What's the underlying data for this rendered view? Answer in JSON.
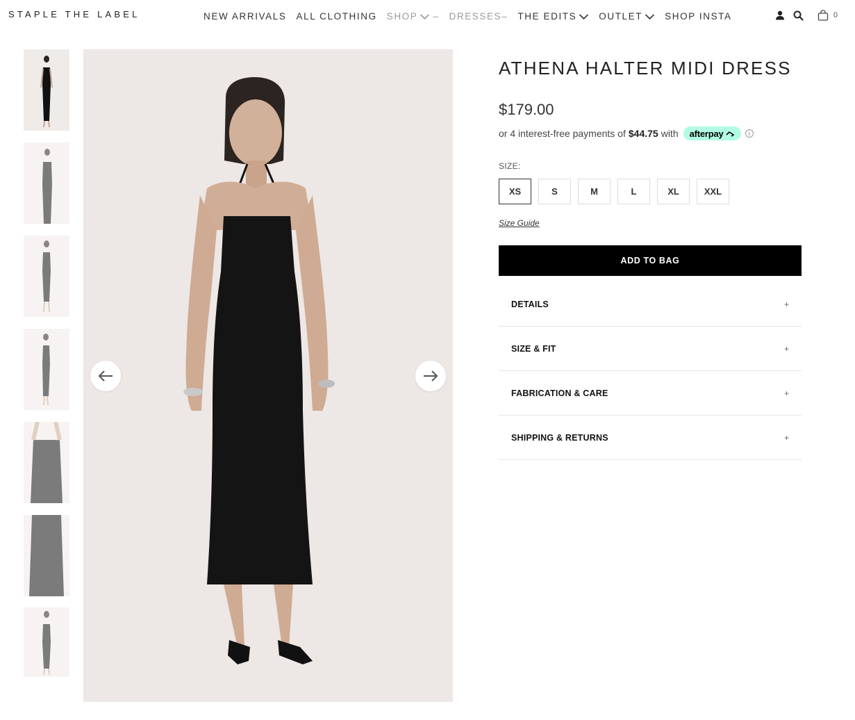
{
  "header": {
    "logo": "STAPLE THE LABEL",
    "nav": [
      {
        "label": "NEW ARRIVALS",
        "muted": false,
        "chevron": false,
        "dash": ""
      },
      {
        "label": "ALL CLOTHING",
        "muted": false,
        "chevron": false,
        "dash": ""
      },
      {
        "label": "SHOP",
        "muted": true,
        "chevron": true,
        "dash": "–"
      },
      {
        "label": "DRESSES–",
        "muted": true,
        "chevron": false,
        "dash": ""
      },
      {
        "label": "THE EDITS",
        "muted": false,
        "chevron": true,
        "dash": ""
      },
      {
        "label": "OUTLET",
        "muted": false,
        "chevron": true,
        "dash": ""
      },
      {
        "label": "SHOP INSTA",
        "muted": false,
        "chevron": false,
        "dash": ""
      }
    ],
    "icons": [
      "account-icon",
      "search-icon",
      "cart-icon"
    ],
    "cart_count": "0"
  },
  "gallery": {
    "thumbnails": [
      {
        "name": "thumbnail-1",
        "active": true
      },
      {
        "name": "thumbnail-2",
        "active": false
      },
      {
        "name": "thumbnail-3",
        "active": false
      },
      {
        "name": "thumbnail-4",
        "active": false
      },
      {
        "name": "thumbnail-5",
        "active": false
      },
      {
        "name": "thumbnail-6",
        "active": false
      },
      {
        "name": "thumbnail-7",
        "active": false
      }
    ],
    "prev_icon": "arrow-left-icon",
    "next_icon": "arrow-right-icon"
  },
  "product": {
    "title": "ATHENA HALTER MIDI DRESS",
    "price": "$179.00",
    "afterpay": {
      "prefix": "or 4 interest-free payments of",
      "amount": "$44.75",
      "suffix": "with",
      "brand": "afterpay",
      "info": "i"
    },
    "size_label": "SIZE:",
    "sizes": [
      "XS",
      "S",
      "M",
      "L",
      "XL",
      "XXL"
    ],
    "selected_size": "XS",
    "size_guide": "Size Guide",
    "add_to_bag": "ADD TO BAG",
    "accordions": [
      {
        "label": "DETAILS",
        "icon": "+"
      },
      {
        "label": "SIZE & FIT",
        "icon": "+"
      },
      {
        "label": "FABRICATION & CARE",
        "icon": "+"
      },
      {
        "label": "SHIPPING & RETURNS",
        "icon": "+"
      }
    ]
  },
  "colors": {
    "accent": "#000000",
    "afterpay_mint": "#b2fce4",
    "image_bg": "#ede7e5",
    "muted_text": "#9a9a9a"
  }
}
